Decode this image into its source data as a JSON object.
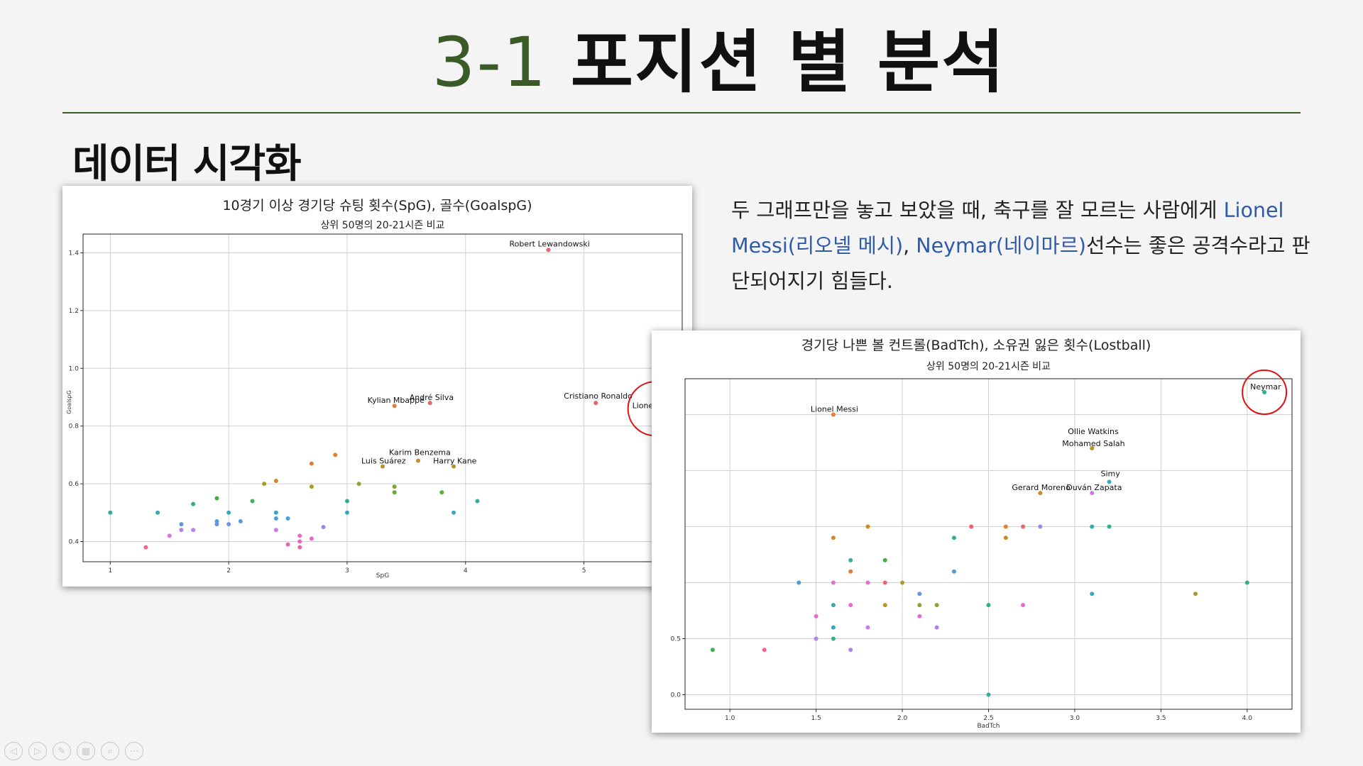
{
  "slide": {
    "title_num": "3-1",
    "title_text": "포지션 별 분석",
    "subtitle": "데이터 시각화",
    "desc_part1": "두 그래프만을 놓고 보았을 때, 축구를 잘 모르는 사람에게 ",
    "desc_hl1": "Lionel Messi(리오넬 메시)",
    "desc_part2": ", ",
    "desc_hl2": "Neymar(네이마르)",
    "desc_part3": "선수는 좋은 공격수라고 판단되어지기 힘들다.",
    "accent_color": "#3a5a27",
    "highlight_color": "#2f5aa8"
  },
  "controls": [
    {
      "name": "prev-slide-icon",
      "glyph": "◁"
    },
    {
      "name": "next-slide-icon",
      "glyph": "▷"
    },
    {
      "name": "pen-icon",
      "glyph": "✎"
    },
    {
      "name": "slides-grid-icon",
      "glyph": "▦"
    },
    {
      "name": "zoom-icon",
      "glyph": "⌕"
    },
    {
      "name": "more-options-icon",
      "glyph": "⋯"
    }
  ],
  "chart_data": [
    {
      "type": "scatter",
      "title": "10경기 이상 경기당 슈팅 횟수(SpG), 골수(GoalspG)",
      "subtitle": "상위 50명의 20-21시즌 비교",
      "xlabel": "SpG",
      "ylabel": "GoalspG",
      "xlim": [
        0.77,
        5.83
      ],
      "ylim": [
        0.33,
        1.465
      ],
      "xticks": [
        1,
        2,
        3,
        4,
        5
      ],
      "yticks": [
        0.4,
        0.6,
        0.8,
        1.0,
        1.2,
        1.4
      ],
      "grid": true,
      "points": [
        {
          "x": 4.7,
          "y": 1.41,
          "c": "#e8636e",
          "label": "Robert Lewandowski"
        },
        {
          "x": 5.1,
          "y": 0.88,
          "c": "#e8636e",
          "label": "Cristiano Ronaldo"
        },
        {
          "x": 5.6,
          "y": 0.86,
          "c": "#de7f3a",
          "label": "Lionel Messi"
        },
        {
          "x": 3.4,
          "y": 0.87,
          "c": "#de7f3a",
          "label": "Kylian Mbappé"
        },
        {
          "x": 3.7,
          "y": 0.88,
          "c": "#e8636e",
          "label": "André Silva"
        },
        {
          "x": 3.6,
          "y": 0.68,
          "c": "#c9892c",
          "label": "Karim Benzema"
        },
        {
          "x": 3.3,
          "y": 0.66,
          "c": "#b89428",
          "label": "Luis Suárez"
        },
        {
          "x": 3.9,
          "y": 0.66,
          "c": "#b89428",
          "label": "Harry Kane"
        },
        {
          "x": 2.9,
          "y": 0.7,
          "c": "#de7f3a"
        },
        {
          "x": 2.7,
          "y": 0.67,
          "c": "#de7f3a"
        },
        {
          "x": 2.4,
          "y": 0.61,
          "c": "#c9892c"
        },
        {
          "x": 2.3,
          "y": 0.6,
          "c": "#a79c2c"
        },
        {
          "x": 2.7,
          "y": 0.59,
          "c": "#a79c2c"
        },
        {
          "x": 3.1,
          "y": 0.6,
          "c": "#8aa82c"
        },
        {
          "x": 3.4,
          "y": 0.59,
          "c": "#7ca830"
        },
        {
          "x": 3.4,
          "y": 0.57,
          "c": "#6aab35"
        },
        {
          "x": 3.8,
          "y": 0.57,
          "c": "#5aae39"
        },
        {
          "x": 1.9,
          "y": 0.55,
          "c": "#3fb043"
        },
        {
          "x": 2.2,
          "y": 0.54,
          "c": "#3bb05a"
        },
        {
          "x": 1.7,
          "y": 0.53,
          "c": "#38b07a"
        },
        {
          "x": 3.0,
          "y": 0.54,
          "c": "#34ae8c"
        },
        {
          "x": 4.1,
          "y": 0.54,
          "c": "#33ad9c"
        },
        {
          "x": 1.0,
          "y": 0.5,
          "c": "#35aa9f"
        },
        {
          "x": 1.4,
          "y": 0.5,
          "c": "#36a9ac"
        },
        {
          "x": 2.0,
          "y": 0.5,
          "c": "#38a8b8"
        },
        {
          "x": 2.4,
          "y": 0.5,
          "c": "#3aa6bf"
        },
        {
          "x": 3.0,
          "y": 0.5,
          "c": "#3ca5c4"
        },
        {
          "x": 3.9,
          "y": 0.5,
          "c": "#3ea4c8"
        },
        {
          "x": 2.4,
          "y": 0.48,
          "c": "#42a3cd"
        },
        {
          "x": 2.5,
          "y": 0.48,
          "c": "#47a1d2"
        },
        {
          "x": 1.9,
          "y": 0.47,
          "c": "#4c9fd6"
        },
        {
          "x": 2.1,
          "y": 0.47,
          "c": "#529cdb"
        },
        {
          "x": 1.6,
          "y": 0.46,
          "c": "#5a98e0"
        },
        {
          "x": 1.9,
          "y": 0.46,
          "c": "#6594e5"
        },
        {
          "x": 2.0,
          "y": 0.46,
          "c": "#7290e9"
        },
        {
          "x": 2.8,
          "y": 0.45,
          "c": "#9a89ec"
        },
        {
          "x": 1.6,
          "y": 0.44,
          "c": "#b184ec"
        },
        {
          "x": 1.7,
          "y": 0.44,
          "c": "#c27fe9"
        },
        {
          "x": 2.4,
          "y": 0.44,
          "c": "#cf7ae3"
        },
        {
          "x": 1.5,
          "y": 0.42,
          "c": "#dd73dc"
        },
        {
          "x": 2.6,
          "y": 0.42,
          "c": "#e56dd2"
        },
        {
          "x": 2.7,
          "y": 0.41,
          "c": "#ea68c7"
        },
        {
          "x": 2.6,
          "y": 0.4,
          "c": "#ec66bb"
        },
        {
          "x": 2.5,
          "y": 0.39,
          "c": "#ed65ae"
        },
        {
          "x": 2.6,
          "y": 0.38,
          "c": "#ee649f"
        },
        {
          "x": 1.3,
          "y": 0.38,
          "c": "#ee6491"
        }
      ],
      "highlight": {
        "x": 5.6,
        "y": 0.86
      }
    },
    {
      "type": "scatter",
      "title": "경기당 나쁜 볼 컨트롤(BadTch), 소유권 잃은 횟수(Lostball)",
      "subtitle": "상위 50명의 20-21시즌 비교",
      "xlabel": "BadTch",
      "ylabel": "",
      "xlim": [
        0.74,
        4.26
      ],
      "ylim": [
        -0.13,
        2.82
      ],
      "xticks": [
        1.0,
        1.5,
        2.0,
        2.5,
        3.0,
        3.5,
        4.0
      ],
      "xtick_labels": [
        "1.0",
        "1.5",
        "2.0",
        "2.5",
        "3.0",
        "3.5",
        "4.0"
      ],
      "yticks": [
        0.0,
        0.5
      ],
      "ytick_labels": [
        "0.0",
        "0.5"
      ],
      "grid": true,
      "points": [
        {
          "x": 4.1,
          "y": 2.7,
          "c": "#33ad9c",
          "label": "Neymar"
        },
        {
          "x": 1.6,
          "y": 2.5,
          "c": "#de7f3a",
          "label": "Lionel Messi"
        },
        {
          "x": 3.1,
          "y": 2.2,
          "c": "#e56dd2",
          "label": "Ollie Watkins"
        },
        {
          "x": 3.1,
          "y": 2.2,
          "c": "#a79c2c",
          "label": "Mohamed Salah"
        },
        {
          "x": 3.2,
          "y": 1.9,
          "c": "#3aa6bf",
          "label": "Simy"
        },
        {
          "x": 2.8,
          "y": 1.8,
          "c": "#c9892c",
          "label": "Gerard Moreno"
        },
        {
          "x": 3.1,
          "y": 1.8,
          "c": "#cf7ae3",
          "label": "Duván Zapata"
        },
        {
          "x": 2.4,
          "y": 1.5,
          "c": "#e8636e"
        },
        {
          "x": 2.6,
          "y": 1.5,
          "c": "#de7f3a"
        },
        {
          "x": 2.7,
          "y": 1.5,
          "c": "#e8636e"
        },
        {
          "x": 2.8,
          "y": 1.5,
          "c": "#9a89ec"
        },
        {
          "x": 3.1,
          "y": 1.5,
          "c": "#36a9ac"
        },
        {
          "x": 3.2,
          "y": 1.5,
          "c": "#34ae8c"
        },
        {
          "x": 1.8,
          "y": 1.5,
          "c": "#c9892c"
        },
        {
          "x": 1.6,
          "y": 1.4,
          "c": "#c9892c"
        },
        {
          "x": 2.3,
          "y": 1.4,
          "c": "#35aa9f"
        },
        {
          "x": 2.6,
          "y": 1.4,
          "c": "#c9892c"
        },
        {
          "x": 1.7,
          "y": 1.2,
          "c": "#33ad9c"
        },
        {
          "x": 1.9,
          "y": 1.2,
          "c": "#3fb043"
        },
        {
          "x": 1.7,
          "y": 1.1,
          "c": "#de7f3a"
        },
        {
          "x": 2.3,
          "y": 1.1,
          "c": "#529cdb"
        },
        {
          "x": 1.4,
          "y": 1.0,
          "c": "#4c9fd6"
        },
        {
          "x": 1.6,
          "y": 1.0,
          "c": "#e56dd2"
        },
        {
          "x": 1.8,
          "y": 1.0,
          "c": "#e56dd2"
        },
        {
          "x": 1.9,
          "y": 1.0,
          "c": "#e8636e"
        },
        {
          "x": 2.0,
          "y": 1.0,
          "c": "#a79c2c"
        },
        {
          "x": 4.0,
          "y": 1.0,
          "c": "#38b07a"
        },
        {
          "x": 2.1,
          "y": 0.9,
          "c": "#6594e5"
        },
        {
          "x": 3.7,
          "y": 0.9,
          "c": "#a79c2c"
        },
        {
          "x": 3.1,
          "y": 0.9,
          "c": "#3aa6bf"
        },
        {
          "x": 1.6,
          "y": 0.8,
          "c": "#36a9ac"
        },
        {
          "x": 1.7,
          "y": 0.8,
          "c": "#e56dd2"
        },
        {
          "x": 1.9,
          "y": 0.8,
          "c": "#b89428"
        },
        {
          "x": 2.1,
          "y": 0.8,
          "c": "#8aa82c"
        },
        {
          "x": 2.2,
          "y": 0.8,
          "c": "#8aa82c"
        },
        {
          "x": 2.5,
          "y": 0.8,
          "c": "#38b07a"
        },
        {
          "x": 2.7,
          "y": 0.8,
          "c": "#e56dd2"
        },
        {
          "x": 1.5,
          "y": 0.7,
          "c": "#e56dd2"
        },
        {
          "x": 2.1,
          "y": 0.7,
          "c": "#e56dd2"
        },
        {
          "x": 1.6,
          "y": 0.6,
          "c": "#3ca5c4"
        },
        {
          "x": 1.8,
          "y": 0.6,
          "c": "#c27fe9"
        },
        {
          "x": 2.2,
          "y": 0.6,
          "c": "#b184ec"
        },
        {
          "x": 1.5,
          "y": 0.5,
          "c": "#b184ec"
        },
        {
          "x": 1.6,
          "y": 0.5,
          "c": "#38b07a"
        },
        {
          "x": 0.9,
          "y": 0.4,
          "c": "#3fb043"
        },
        {
          "x": 1.2,
          "y": 0.4,
          "c": "#ee6491"
        },
        {
          "x": 1.7,
          "y": 0.4,
          "c": "#b184ec"
        },
        {
          "x": 2.5,
          "y": 0.0,
          "c": "#33ad9c"
        }
      ],
      "highlight": {
        "x": 4.1,
        "y": 2.7
      }
    }
  ]
}
